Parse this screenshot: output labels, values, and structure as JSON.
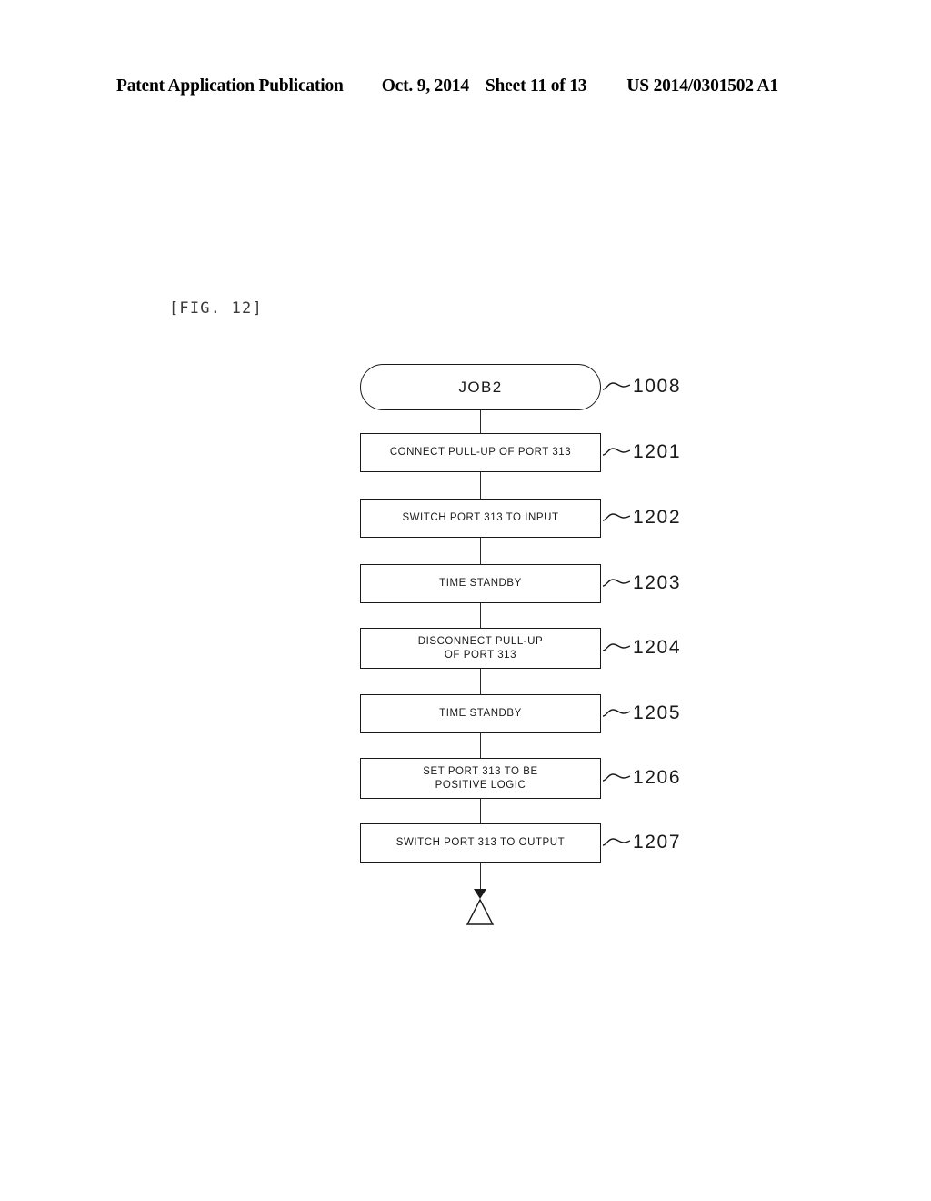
{
  "header": {
    "publication": "Patent Application Publication",
    "date": "Oct. 9, 2014",
    "sheet": "Sheet 11 of 13",
    "doc_number": "US 2014/0301502 A1"
  },
  "figure": {
    "label": "[FIG. 12]"
  },
  "colors": {
    "ink": "#1a1a1a",
    "line": "#2a2a2a",
    "paper": "#ffffff",
    "fig_label": "#3a3a3a"
  },
  "flowchart": {
    "type": "flowchart",
    "orientation": "vertical",
    "nodes": [
      {
        "id": "1008",
        "shape": "terminal",
        "text": "JOB2",
        "ref": "1008"
      },
      {
        "id": "1201",
        "shape": "process",
        "text": "CONNECT PULL-UP OF PORT 313",
        "ref": "1201"
      },
      {
        "id": "1202",
        "shape": "process",
        "text": "SWITCH PORT 313 TO INPUT",
        "ref": "1202"
      },
      {
        "id": "1203",
        "shape": "process",
        "text": "TIME STANDBY",
        "ref": "1203"
      },
      {
        "id": "1204",
        "shape": "process",
        "text": "DISCONNECT PULL-UP\nOF PORT 313",
        "ref": "1204"
      },
      {
        "id": "1205",
        "shape": "process",
        "text": "TIME STANDBY",
        "ref": "1205"
      },
      {
        "id": "1206",
        "shape": "process",
        "text": "SET PORT 313 TO BE\nPOSITIVE LOGIC",
        "ref": "1206"
      },
      {
        "id": "1207",
        "shape": "process",
        "text": "SWITCH PORT 313 TO OUTPUT",
        "ref": "1207"
      }
    ],
    "terminator": "return-symbol"
  }
}
